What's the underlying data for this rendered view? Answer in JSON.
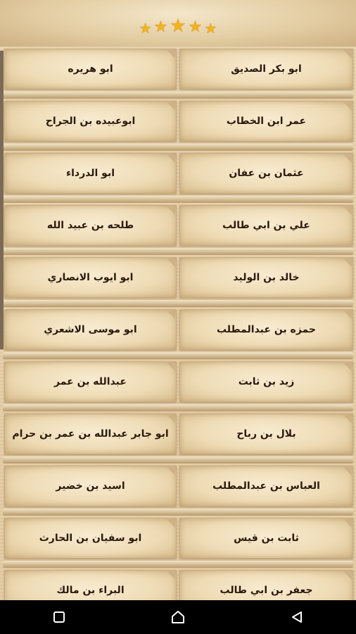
{
  "header": {
    "rating_stars": 5
  },
  "items": [
    {
      "right": "ابو بكر الصديق",
      "left": "ابو هريره"
    },
    {
      "right": "عمر ابن الخطاب",
      "left": "ابوعبيده بن الجراح"
    },
    {
      "right": "عثمان بن عفان",
      "left": "ابو الدرداء"
    },
    {
      "right": "علي بن ابي طالب",
      "left": "طلحه بن عبيد الله"
    },
    {
      "right": "خالد بن الوليد",
      "left": "ابو ايوب الانصاري"
    },
    {
      "right": "حمزه بن عبدالمطلب",
      "left": "ابو موسى الاشعري"
    },
    {
      "right": "زيد بن ثابت",
      "left": "عبدالله بن عمر"
    },
    {
      "right": "بلال بن رباح",
      "left": "ابو جابر عبدالله بن عمر بن حرام"
    },
    {
      "right": "العباس بن عبدالمطلب",
      "left": "اسيد بن خضير"
    },
    {
      "right": "ثابت بن قيس",
      "left": "ابو سفيان بن الحارث"
    },
    {
      "right": "جعفر بن ابي طالب",
      "left": "البراء بن مالك"
    }
  ],
  "navigation": {
    "buttons": [
      "recent-apps",
      "home",
      "back"
    ]
  }
}
